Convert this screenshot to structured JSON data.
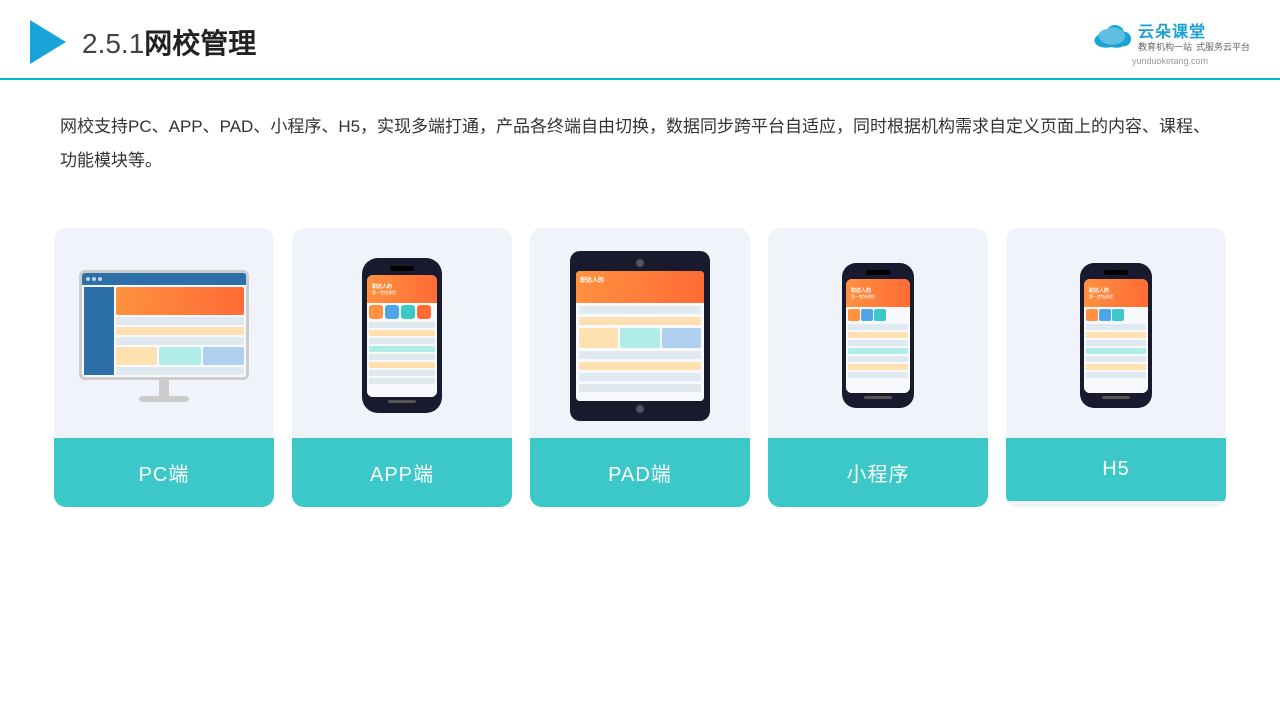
{
  "header": {
    "section_number": "2.5.1",
    "title": "网校管理",
    "logo": {
      "name": "云朵课堂",
      "tagline_line1": "教育机构一站",
      "tagline_line2": "式服务云平台",
      "url": "yunduoketang.com"
    }
  },
  "description": "网校支持PC、APP、PAD、小程序、H5，实现多端打通，产品各终端自由切换，数据同步跨平台自适应，同时根据机构需求自定义页面上的内容、课程、功能模块等。",
  "cards": [
    {
      "id": "pc",
      "label": "PC端",
      "device": "pc"
    },
    {
      "id": "app",
      "label": "APP端",
      "device": "phone"
    },
    {
      "id": "pad",
      "label": "PAD端",
      "device": "tablet"
    },
    {
      "id": "miniprogram",
      "label": "小程序",
      "device": "phone-mini"
    },
    {
      "id": "h5",
      "label": "H5",
      "device": "phone-mini"
    }
  ]
}
